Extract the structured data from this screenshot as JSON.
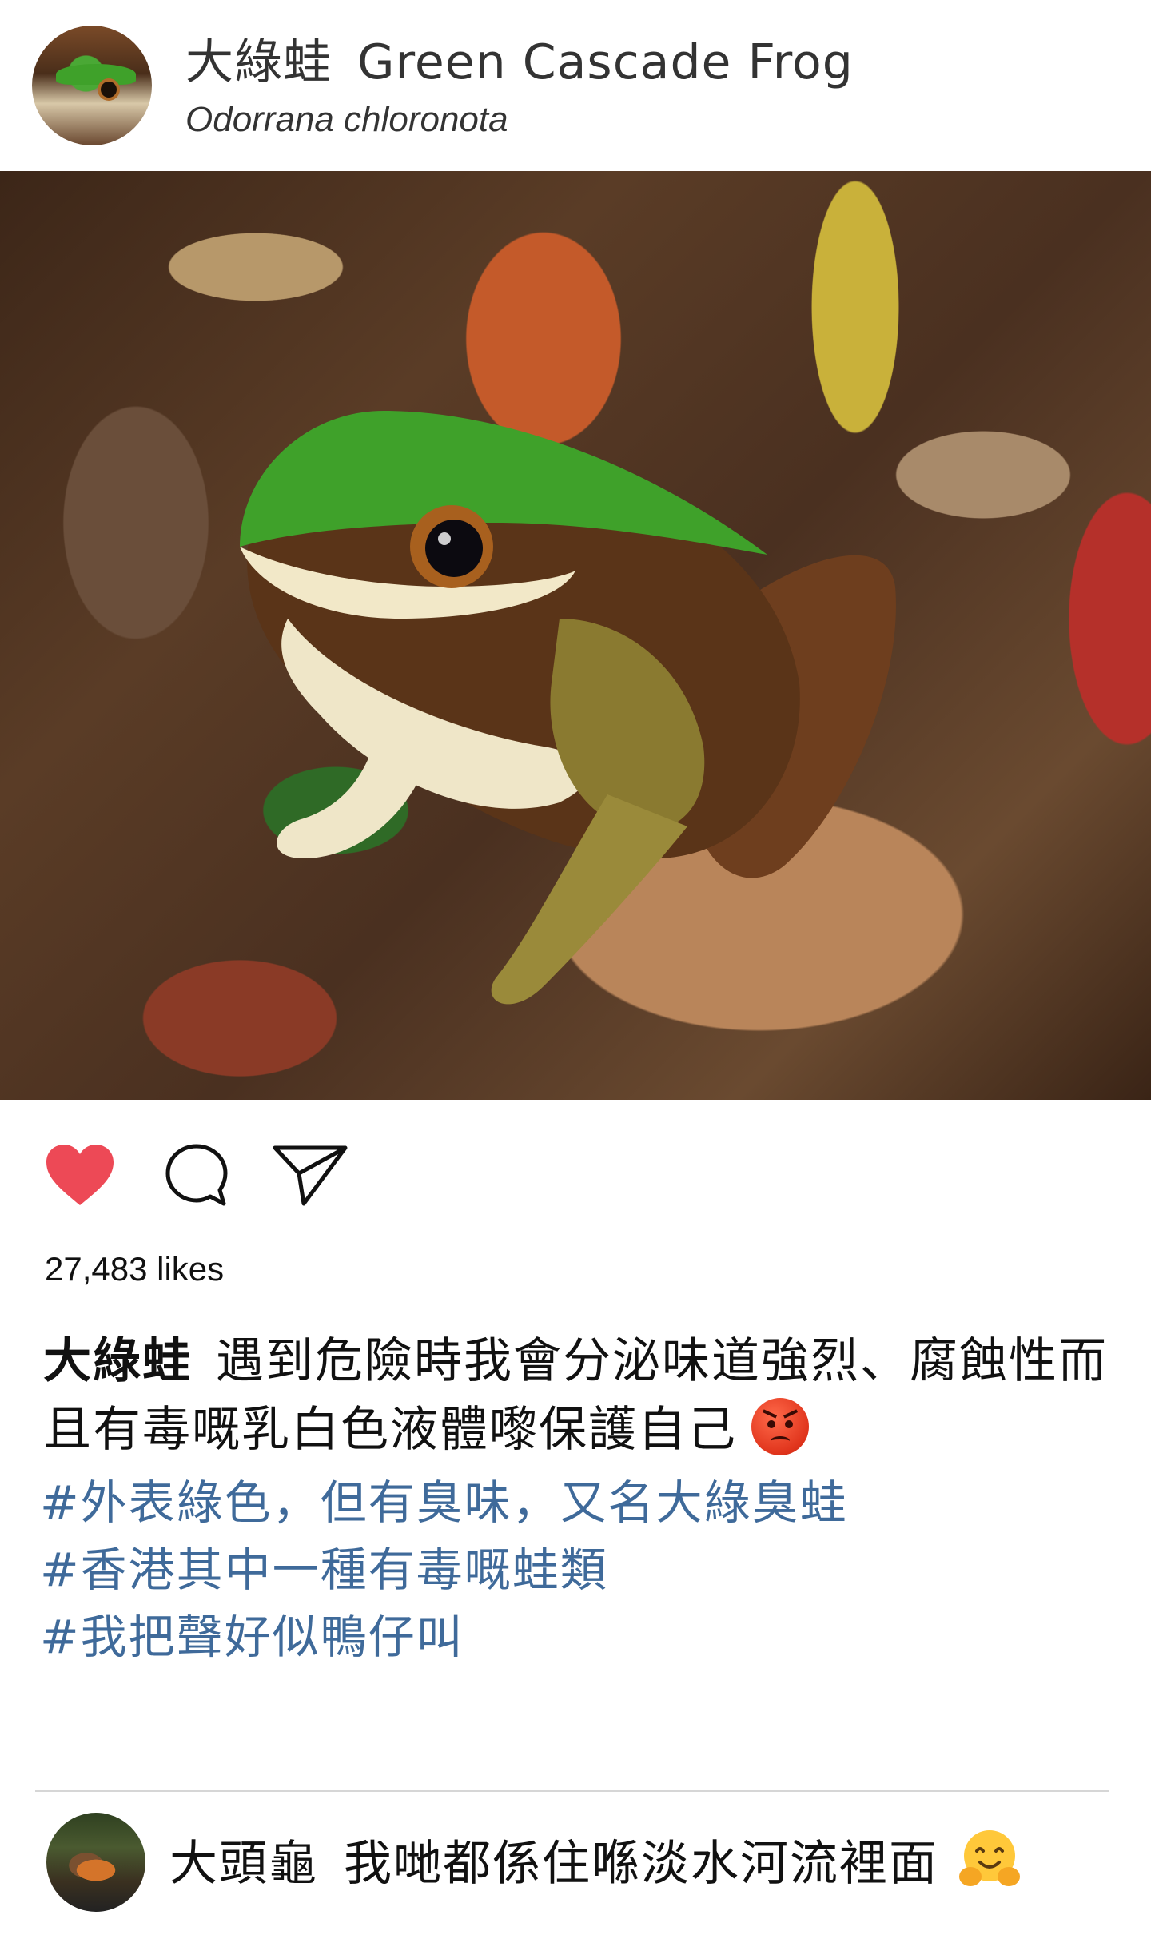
{
  "header": {
    "name_cn": "大綠蛙",
    "name_en": "Green Cascade Frog",
    "scientific_name": "Odorrana chloronota"
  },
  "post": {
    "likes_text": "27,483 likes",
    "liked": true,
    "caption_author": "大綠蛙",
    "caption_text": "遇到危險時我會分泌味道強烈、腐蝕性而且有毒嘅乳白色液體嚟保護自己",
    "caption_emoji": "angry-face-emoji",
    "hashtags": [
      "#外表綠色，但有臭味，又名大綠臭蛙",
      "#香港其中一種有毒嘅蛙類",
      "#我把聲好似鴨仔叫"
    ]
  },
  "comment": {
    "author": "大頭龜",
    "text": "我哋都係住喺淡水河流裡面",
    "emoji": "hugging-face-emoji"
  },
  "colors": {
    "heart": "#ed4956",
    "hashtag": "#3f6a9a",
    "frog_green": "#3fa12a"
  }
}
